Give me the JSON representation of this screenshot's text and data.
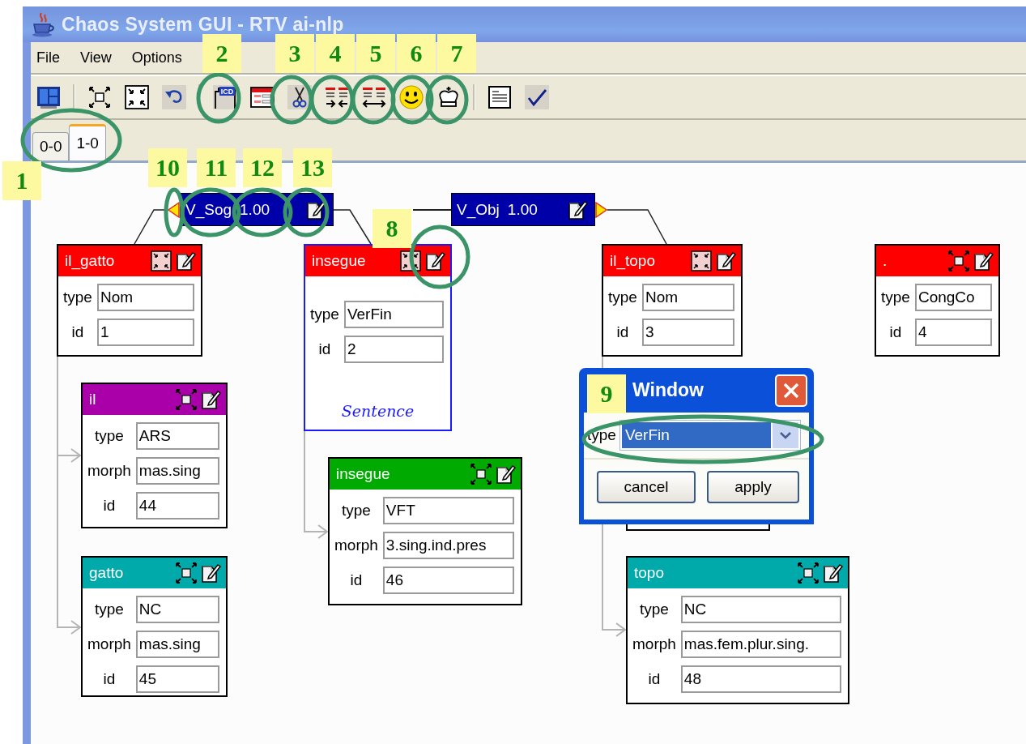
{
  "window": {
    "title": "Chaos System GUI - RTV ai-nlp"
  },
  "menu": [
    "File",
    "View",
    "Options"
  ],
  "toolbar": [
    {
      "kind": "tiles"
    },
    {
      "kind": "sep"
    },
    {
      "kind": "fit"
    },
    {
      "kind": "expand"
    },
    {
      "kind": "undo"
    },
    {
      "kind": "sep"
    },
    {
      "kind": "card",
      "text": "ICD"
    },
    {
      "kind": "form"
    },
    {
      "kind": "cut"
    },
    {
      "kind": "merge"
    },
    {
      "kind": "split"
    },
    {
      "kind": "smiley"
    },
    {
      "kind": "crown"
    },
    {
      "kind": "sep"
    },
    {
      "kind": "document"
    },
    {
      "kind": "check"
    }
  ],
  "tabs": [
    {
      "label": "0-0",
      "selected": false
    },
    {
      "label": "1-0",
      "selected": true
    }
  ],
  "relations": [
    {
      "name": "V_Sog",
      "score": "1.00",
      "kind": "left"
    },
    {
      "name": "V_Obj",
      "score": "1.00",
      "kind": "right"
    }
  ],
  "nodes": [
    {
      "kind": "word",
      "title": "il_gatto",
      "color": "#ff0000",
      "expanded": true,
      "fields": [
        {
          "label": "type",
          "value": "Nom"
        },
        {
          "label": "id",
          "value": "1"
        }
      ]
    },
    {
      "kind": "sentence",
      "title": "insegue",
      "color": "#ff0000",
      "expanded": true,
      "fields": [
        {
          "label": "type",
          "value": "VerFin"
        },
        {
          "label": "id",
          "value": "2"
        }
      ],
      "footer": "Sentence"
    },
    {
      "kind": "word",
      "title": "il_topo",
      "color": "#ff0000",
      "expanded": true,
      "fields": [
        {
          "label": "type",
          "value": "Nom"
        },
        {
          "label": "id",
          "value": "3"
        }
      ]
    },
    {
      "kind": "word",
      "title": ".",
      "color": "#ff0000",
      "expanded": false,
      "fields": [
        {
          "label": "type",
          "value": "CongCo"
        },
        {
          "label": "id",
          "value": "4"
        }
      ]
    },
    {
      "kind": "word",
      "title": "il",
      "color": "#aa00aa",
      "expanded": false,
      "fields": [
        {
          "label": "type",
          "value": "ARS"
        },
        {
          "label": "morph",
          "value": "mas.sing"
        },
        {
          "label": "id",
          "value": "44"
        }
      ]
    },
    {
      "kind": "word",
      "title": "insegue",
      "color": "#00aa00",
      "expanded": false,
      "fields": [
        {
          "label": "type",
          "value": "VFT"
        },
        {
          "label": "morph",
          "value": "3.sing.ind.pres"
        },
        {
          "label": "id",
          "value": "46"
        }
      ]
    },
    {
      "kind": "word",
      "title": "gatto",
      "color": "#00aaaa",
      "expanded": false,
      "fields": [
        {
          "label": "type",
          "value": "NC"
        },
        {
          "label": "morph",
          "value": "mas.sing"
        },
        {
          "label": "id",
          "value": "45"
        }
      ]
    },
    {
      "kind": "word",
      "title": "topo",
      "color": "#00aaaa",
      "expanded": false,
      "fields": [
        {
          "label": "type",
          "value": "NC"
        },
        {
          "label": "morph",
          "value": "mas.fem.plur.sing."
        },
        {
          "label": "id",
          "value": "48"
        }
      ]
    }
  ],
  "dialog": {
    "title": "Window",
    "field_label": "type",
    "value": "VerFin",
    "buttons": [
      "cancel",
      "apply"
    ]
  },
  "annotations": [
    "1",
    "2",
    "3",
    "4",
    "5",
    "6",
    "7",
    "8",
    "9",
    "10",
    "11",
    "12",
    "13"
  ]
}
